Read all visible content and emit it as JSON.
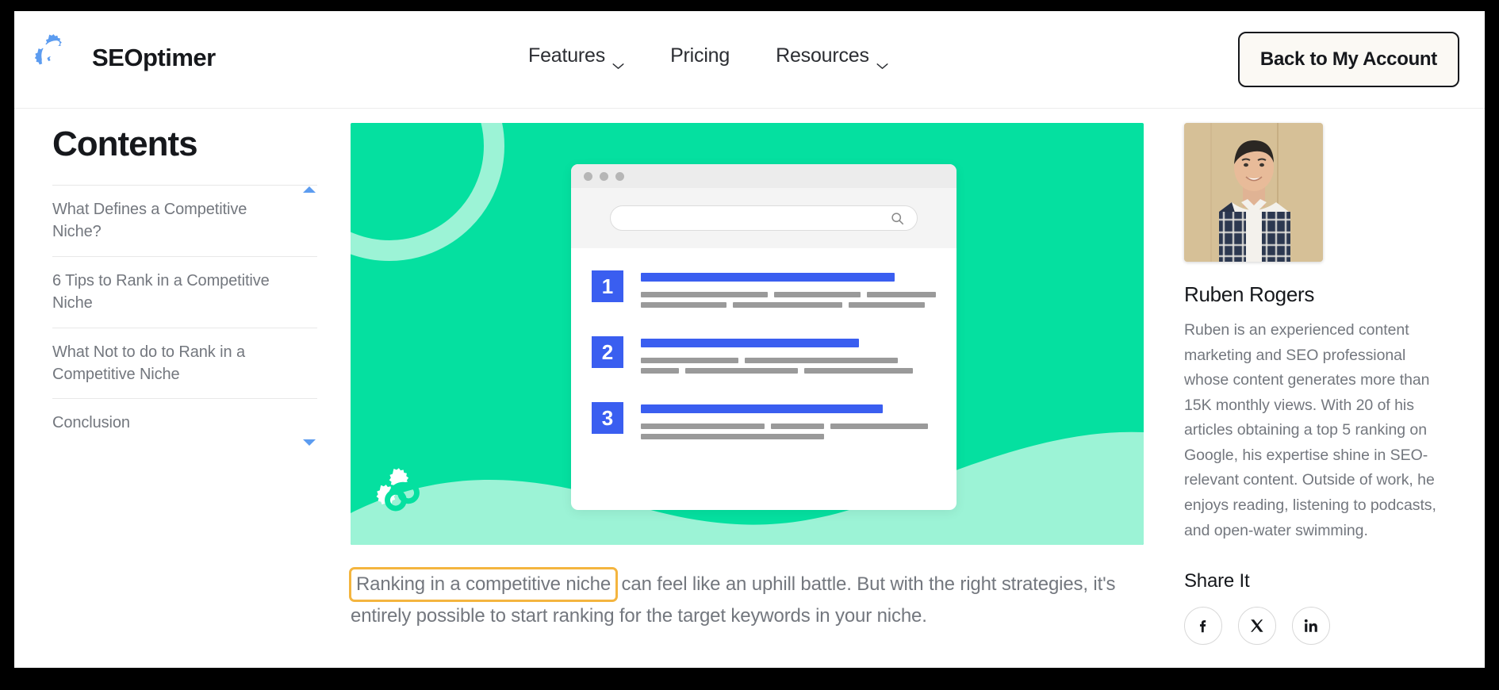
{
  "colors": {
    "brand_blue": "#5c9cf0",
    "hero_green": "#05e0a0",
    "hero_mint": "#9cf3d6",
    "result_blue": "#3a5ef0",
    "highlight_orange": "#f4b53f",
    "text_dark": "#16181c",
    "text_muted": "#73777e"
  },
  "header": {
    "brand_name": "SEOptimer",
    "logo_icon": "seoptimer-gears-icon",
    "nav": [
      {
        "label": "Features",
        "has_dropdown": true,
        "icon": "chevron-down-icon"
      },
      {
        "label": "Pricing",
        "has_dropdown": false,
        "icon": ""
      },
      {
        "label": "Resources",
        "has_dropdown": true,
        "icon": "chevron-down-icon"
      }
    ],
    "account_button": "Back to My Account"
  },
  "toc": {
    "title": "Contents",
    "scroll_up_icon": "triangle-up-icon",
    "scroll_down_icon": "triangle-down-icon",
    "items": [
      {
        "label": "What Defines a Competitive Niche?"
      },
      {
        "label": "6 Tips to Rank in a Competitive Niche"
      },
      {
        "label": "What Not to do to Rank in a Competitive Niche"
      },
      {
        "label": "Conclusion"
      }
    ]
  },
  "hero": {
    "gear_icon": "seoptimer-gears-icon",
    "browser": {
      "window_dots": 3,
      "search_icon": "search-icon",
      "search_value": "",
      "results": [
        {
          "rank": "1"
        },
        {
          "rank": "2"
        },
        {
          "rank": "3"
        }
      ]
    }
  },
  "article": {
    "paragraph_highlight": "Ranking in a competitive niche",
    "paragraph_rest": " can feel like an uphill battle. But with the right strategies, it's entirely possible to start ranking for the target keywords in your niche."
  },
  "author": {
    "photo_alt": "author-portrait",
    "name": "Ruben Rogers",
    "bio": "Ruben is an experienced content marketing and SEO professional whose content generates more than 15K monthly views. With 20 of his articles obtaining a top 5 ranking on Google, his expertise shine in SEO-relevant content. Outside of work, he enjoys reading, listening to podcasts, and open-water swimming.",
    "share_title": "Share It",
    "share_buttons": [
      {
        "name": "facebook",
        "icon": "facebook-icon",
        "glyph": "f"
      },
      {
        "name": "x-twitter",
        "icon": "x-twitter-icon",
        "glyph": "X"
      },
      {
        "name": "linkedin",
        "icon": "linkedin-icon",
        "glyph": "in"
      }
    ]
  }
}
